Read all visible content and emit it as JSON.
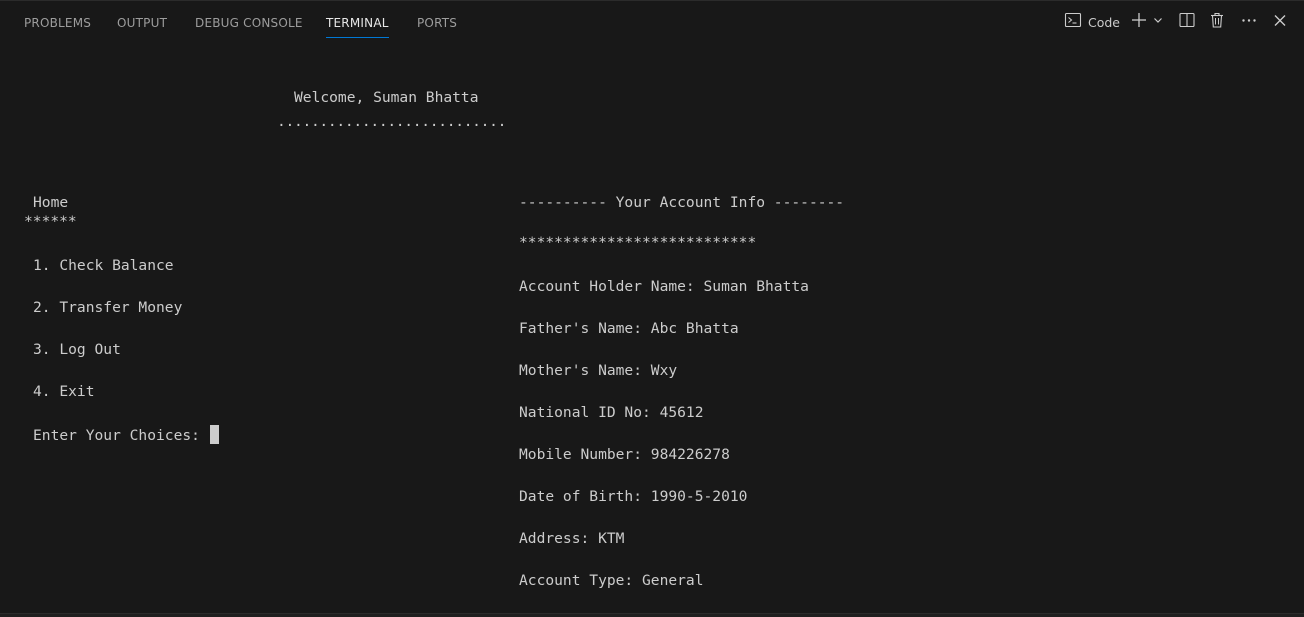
{
  "tabs": [
    {
      "label": "PROBLEMS",
      "active": false
    },
    {
      "label": "OUTPUT",
      "active": false
    },
    {
      "label": "DEBUG CONSOLE",
      "active": false
    },
    {
      "label": "TERMINAL",
      "active": true
    },
    {
      "label": "PORTS",
      "active": false
    }
  ],
  "toolbar": {
    "terminal_profile_label": "Code",
    "icons": [
      "terminal-icon",
      "plus-icon",
      "chevron-down-icon",
      "split-icon",
      "trash-icon",
      "more-icon",
      "close-icon"
    ]
  },
  "accent_color": "#0078d4",
  "terminal": {
    "welcome": "Welcome, Suman Bhatta",
    "welcome_rule": "...........................",
    "menu": {
      "title": "Home",
      "rule": "******",
      "items": [
        "1. Check Balance",
        "2. Transfer Money",
        "3. Log Out",
        "4. Exit"
      ],
      "prompt": "Enter Your Choices: "
    },
    "account": {
      "header": "---------- Your Account Info --------",
      "rule": "***************************",
      "fields": [
        "Account Holder Name: Suman Bhatta",
        "Father's Name: Abc Bhatta",
        "Mother's Name: Wxy",
        "National ID No: 45612",
        "Mobile Number: 984226278",
        "Date of Birth: 1990-5-2010",
        "Address: KTM",
        "Account Type: General"
      ]
    }
  }
}
